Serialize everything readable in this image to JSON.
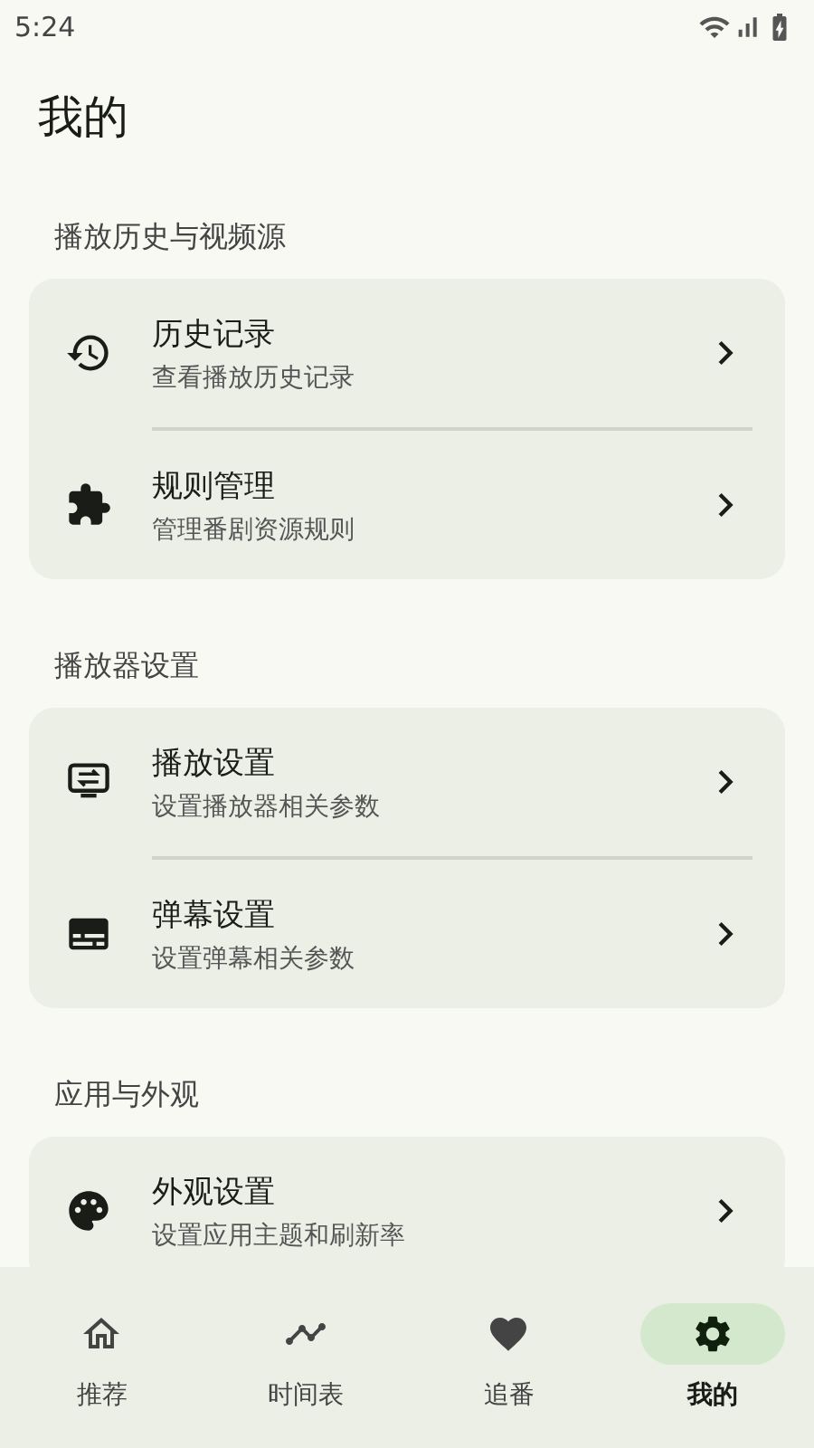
{
  "status_bar": {
    "time": "5:24"
  },
  "title": "我的",
  "sections": [
    {
      "label": "播放历史与视频源",
      "items": [
        {
          "title": "历史记录",
          "subtitle": "查看播放历史记录"
        },
        {
          "title": "规则管理",
          "subtitle": "管理番剧资源规则"
        }
      ]
    },
    {
      "label": "播放器设置",
      "items": [
        {
          "title": "播放设置",
          "subtitle": "设置播放器相关参数"
        },
        {
          "title": "弹幕设置",
          "subtitle": "设置弹幕相关参数"
        }
      ]
    },
    {
      "label": "应用与外观",
      "items": [
        {
          "title": "外观设置",
          "subtitle": "设置应用主题和刷新率"
        }
      ]
    }
  ],
  "nav": [
    {
      "label": "推荐",
      "selected": false
    },
    {
      "label": "时间表",
      "selected": false
    },
    {
      "label": "追番",
      "selected": false
    },
    {
      "label": "我的",
      "selected": true
    }
  ]
}
